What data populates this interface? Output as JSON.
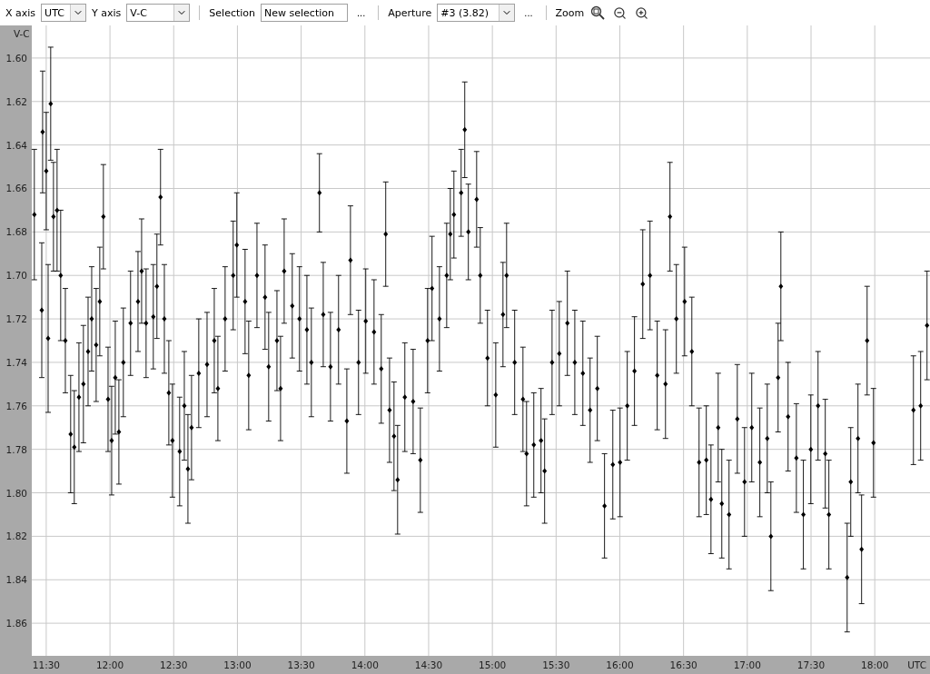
{
  "toolbar": {
    "x_axis": {
      "label": "X axis",
      "value": "UTC"
    },
    "y_axis": {
      "label": "Y axis",
      "value": "V-C"
    },
    "selection": {
      "label": "Selection",
      "value": "New selection",
      "more": "..."
    },
    "aperture": {
      "label": "Aperture",
      "value": "#3 (3.82)",
      "more": "..."
    },
    "zoom": {
      "label": "Zoom"
    }
  },
  "chart": {
    "chart_data": {
      "type": "scatter",
      "xlabel": "UTC",
      "ylabel": "V-C",
      "xlim": [
        683.2,
        1106
      ],
      "ylim": [
        1.875,
        1.585
      ],
      "grid": true,
      "xticks": [
        {
          "value": 690,
          "label": "11:30"
        },
        {
          "value": 720,
          "label": "12:00"
        },
        {
          "value": 750,
          "label": "12:30"
        },
        {
          "value": 780,
          "label": "13:00"
        },
        {
          "value": 810,
          "label": "13:30"
        },
        {
          "value": 840,
          "label": "14:00"
        },
        {
          "value": 870,
          "label": "14:30"
        },
        {
          "value": 900,
          "label": "15:00"
        },
        {
          "value": 930,
          "label": "15:30"
        },
        {
          "value": 960,
          "label": "16:00"
        },
        {
          "value": 990,
          "label": "16:30"
        },
        {
          "value": 1020,
          "label": "17:00"
        },
        {
          "value": 1050,
          "label": "17:30"
        },
        {
          "value": 1080,
          "label": "18:00"
        }
      ],
      "yticks": [
        {
          "value": 1.6,
          "label": "1.60"
        },
        {
          "value": 1.62,
          "label": "1.62"
        },
        {
          "value": 1.64,
          "label": "1.64"
        },
        {
          "value": 1.66,
          "label": "1.66"
        },
        {
          "value": 1.68,
          "label": "1.68"
        },
        {
          "value": 1.7,
          "label": "1.70"
        },
        {
          "value": 1.72,
          "label": "1.72"
        },
        {
          "value": 1.74,
          "label": "1.74"
        },
        {
          "value": 1.76,
          "label": "1.76"
        },
        {
          "value": 1.78,
          "label": "1.78"
        },
        {
          "value": 1.8,
          "label": "1.80"
        },
        {
          "value": 1.82,
          "label": "1.82"
        },
        {
          "value": 1.84,
          "label": "1.84"
        },
        {
          "value": 1.86,
          "label": "1.86"
        }
      ],
      "x": [
        684.4,
        687.9,
        688.3,
        690.0,
        690.9,
        692.1,
        693.4,
        695.1,
        696.8,
        699.0,
        701.5,
        703.2,
        705.4,
        707.5,
        709.7,
        711.4,
        713.5,
        715.2,
        716.9,
        719.1,
        720.8,
        722.5,
        724.2,
        726.3,
        729.7,
        733.2,
        734.9,
        737.0,
        740.4,
        742.1,
        743.8,
        745.6,
        747.7,
        749.4,
        752.8,
        755.0,
        756.7,
        758.4,
        761.8,
        765.7,
        769.1,
        770.8,
        774.2,
        778.0,
        779.7,
        783.6,
        785.3,
        789.2,
        793.0,
        794.7,
        798.6,
        800.3,
        802.0,
        805.8,
        809.2,
        812.7,
        814.8,
        818.6,
        820.4,
        823.8,
        827.6,
        831.5,
        833.2,
        837.0,
        840.4,
        844.3,
        847.7,
        849.8,
        851.6,
        853.7,
        855.4,
        858.8,
        862.7,
        866.1,
        869.5,
        871.6,
        875.1,
        878.5,
        880.2,
        881.9,
        885.3,
        887.0,
        888.7,
        892.6,
        894.3,
        897.7,
        901.6,
        905.0,
        906.7,
        910.5,
        914.4,
        916.1,
        919.5,
        922.9,
        924.6,
        928.1,
        931.5,
        935.3,
        938.8,
        942.6,
        946.0,
        949.4,
        952.8,
        956.7,
        960.1,
        963.5,
        966.9,
        970.8,
        974.2,
        977.6,
        981.5,
        983.6,
        986.6,
        990.5,
        993.9,
        997.3,
        1000.7,
        1002.9,
        1006.3,
        1008.0,
        1011.4,
        1015.3,
        1018.7,
        1022.1,
        1025.9,
        1029.4,
        1031.1,
        1034.5,
        1035.8,
        1039.2,
        1043.1,
        1046.4,
        1049.9,
        1053.3,
        1056.7,
        1058.4,
        1067.0,
        1068.7,
        1072.1,
        1073.8,
        1076.4,
        1079.4,
        1098.2,
        1101.6,
        1104.6
      ],
      "series": [
        {
          "color": "#000000",
          "errors": [
            0.03,
            0.031,
            0.028,
            0.027,
            0.034,
            0.026,
            0.025,
            0.028,
            0.03,
            0.024,
            0.027,
            0.026,
            0.025,
            0.027,
            0.025,
            0.024,
            0.026,
            0.025,
            0.024,
            0.024,
            0.025,
            0.026,
            0.024,
            0.025,
            0.024,
            0.023,
            0.024,
            0.025,
            0.024,
            0.024,
            0.022,
            0.025,
            0.024,
            0.026,
            0.025,
            0.025,
            0.025,
            0.024,
            0.025,
            0.024,
            0.024,
            0.024,
            0.024,
            0.025,
            0.024,
            0.024,
            0.025,
            0.024,
            0.024,
            0.025,
            0.023,
            0.024,
            0.024,
            0.024,
            0.024,
            0.025,
            0.025,
            0.018,
            0.024,
            0.025,
            0.025,
            0.024,
            0.025,
            0.024,
            0.024,
            0.024,
            0.025,
            0.024,
            0.024,
            0.025,
            0.025,
            0.025,
            0.024,
            0.024,
            0.024,
            0.024,
            0.024,
            0.024,
            0.021,
            0.02,
            0.02,
            0.022,
            0.022,
            0.022,
            0.022,
            0.022,
            0.024,
            0.024,
            0.024,
            0.024,
            0.024,
            0.024,
            0.024,
            0.024,
            0.024,
            0.024,
            0.024,
            0.024,
            0.024,
            0.024,
            0.024,
            0.024,
            0.024,
            0.025,
            0.025,
            0.025,
            0.025,
            0.025,
            0.025,
            0.025,
            0.025,
            0.025,
            0.025,
            0.025,
            0.025,
            0.025,
            0.025,
            0.025,
            0.025,
            0.025,
            0.025,
            0.025,
            0.025,
            0.025,
            0.025,
            0.025,
            0.025,
            0.025,
            0.025,
            0.025,
            0.025,
            0.025,
            0.025,
            0.025,
            0.025,
            0.025,
            0.025,
            0.025,
            0.025,
            0.025,
            0.025,
            0.025,
            0.025,
            0.025,
            0.025
          ],
          "values": [
            1.672,
            1.716,
            1.634,
            1.652,
            1.729,
            1.621,
            1.673,
            1.67,
            1.7,
            1.73,
            1.773,
            1.779,
            1.756,
            1.75,
            1.735,
            1.72,
            1.732,
            1.712,
            1.673,
            1.757,
            1.776,
            1.747,
            1.772,
            1.74,
            1.722,
            1.712,
            1.698,
            1.722,
            1.719,
            1.705,
            1.664,
            1.72,
            1.754,
            1.776,
            1.781,
            1.76,
            1.789,
            1.77,
            1.745,
            1.741,
            1.73,
            1.752,
            1.72,
            1.7,
            1.686,
            1.712,
            1.746,
            1.7,
            1.71,
            1.742,
            1.73,
            1.752,
            1.698,
            1.714,
            1.72,
            1.725,
            1.74,
            1.662,
            1.718,
            1.742,
            1.725,
            1.767,
            1.693,
            1.74,
            1.721,
            1.726,
            1.743,
            1.681,
            1.762,
            1.774,
            1.794,
            1.756,
            1.758,
            1.785,
            1.73,
            1.706,
            1.72,
            1.7,
            1.681,
            1.672,
            1.662,
            1.633,
            1.68,
            1.665,
            1.7,
            1.738,
            1.755,
            1.718,
            1.7,
            1.74,
            1.757,
            1.782,
            1.778,
            1.776,
            1.79,
            1.74,
            1.736,
            1.722,
            1.74,
            1.745,
            1.762,
            1.752,
            1.806,
            1.787,
            1.786,
            1.76,
            1.744,
            1.704,
            1.7,
            1.746,
            1.75,
            1.673,
            1.72,
            1.712,
            1.735,
            1.786,
            1.785,
            1.803,
            1.77,
            1.805,
            1.81,
            1.766,
            1.795,
            1.77,
            1.786,
            1.775,
            1.82,
            1.747,
            1.705,
            1.765,
            1.784,
            1.81,
            1.78,
            1.76,
            1.782,
            1.81,
            1.839,
            1.795,
            1.775,
            1.826,
            1.73,
            1.777,
            1.762,
            1.76,
            1.723
          ]
        }
      ]
    }
  }
}
